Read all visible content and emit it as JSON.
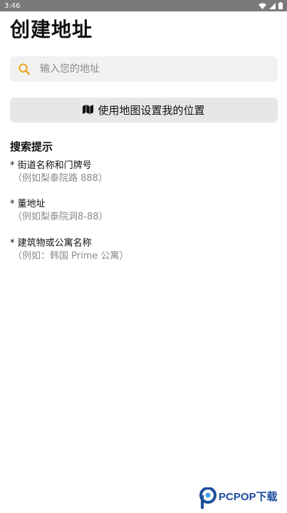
{
  "status_bar": {
    "time": "3:46"
  },
  "page": {
    "title": "创建地址"
  },
  "search": {
    "placeholder": "输入您的地址",
    "value": ""
  },
  "map_button": {
    "label": "使用地图设置我的位置"
  },
  "tips": {
    "title": "搜索提示",
    "items": [
      {
        "main": "* 街道名称和门牌号",
        "example": "（例如梨泰院路 888）"
      },
      {
        "main": "* 董地址",
        "example": "（例如梨泰院洞8-88）"
      },
      {
        "main": "* 建筑物或公寓名称",
        "example": "（例如：韩国 Prime 公寓）"
      }
    ]
  },
  "watermark": {
    "brand": "PCPOP下载"
  },
  "colors": {
    "accent": "#f0a11b",
    "status_bar": "#7a7a7a",
    "watermark": "#1d4f9c"
  },
  "icons": {
    "search": "search-icon",
    "map": "map-icon"
  }
}
